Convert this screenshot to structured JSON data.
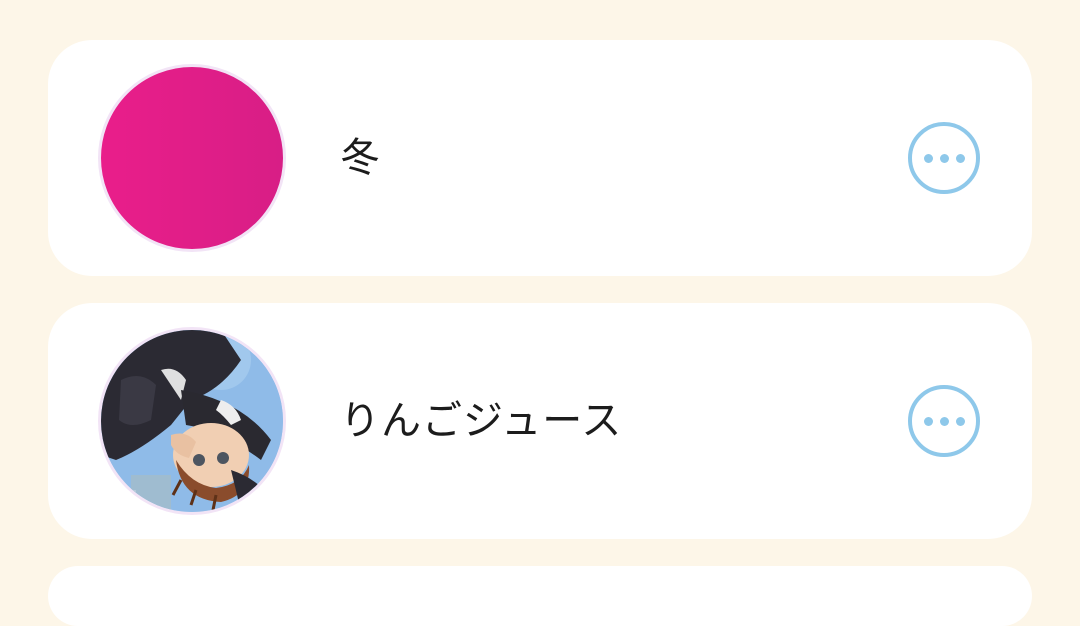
{
  "contacts": [
    {
      "name": "冬",
      "avatar_type": "solid-color",
      "avatar_color": "#e61e8c",
      "menu_icon": "more-horizontal-icon"
    },
    {
      "name": "りんごジュース",
      "avatar_type": "illustration",
      "menu_icon": "more-horizontal-icon"
    }
  ],
  "colors": {
    "background": "#fdf6e8",
    "card": "#ffffff",
    "accent": "#8ec8ea",
    "text": "#1c1c1c"
  }
}
